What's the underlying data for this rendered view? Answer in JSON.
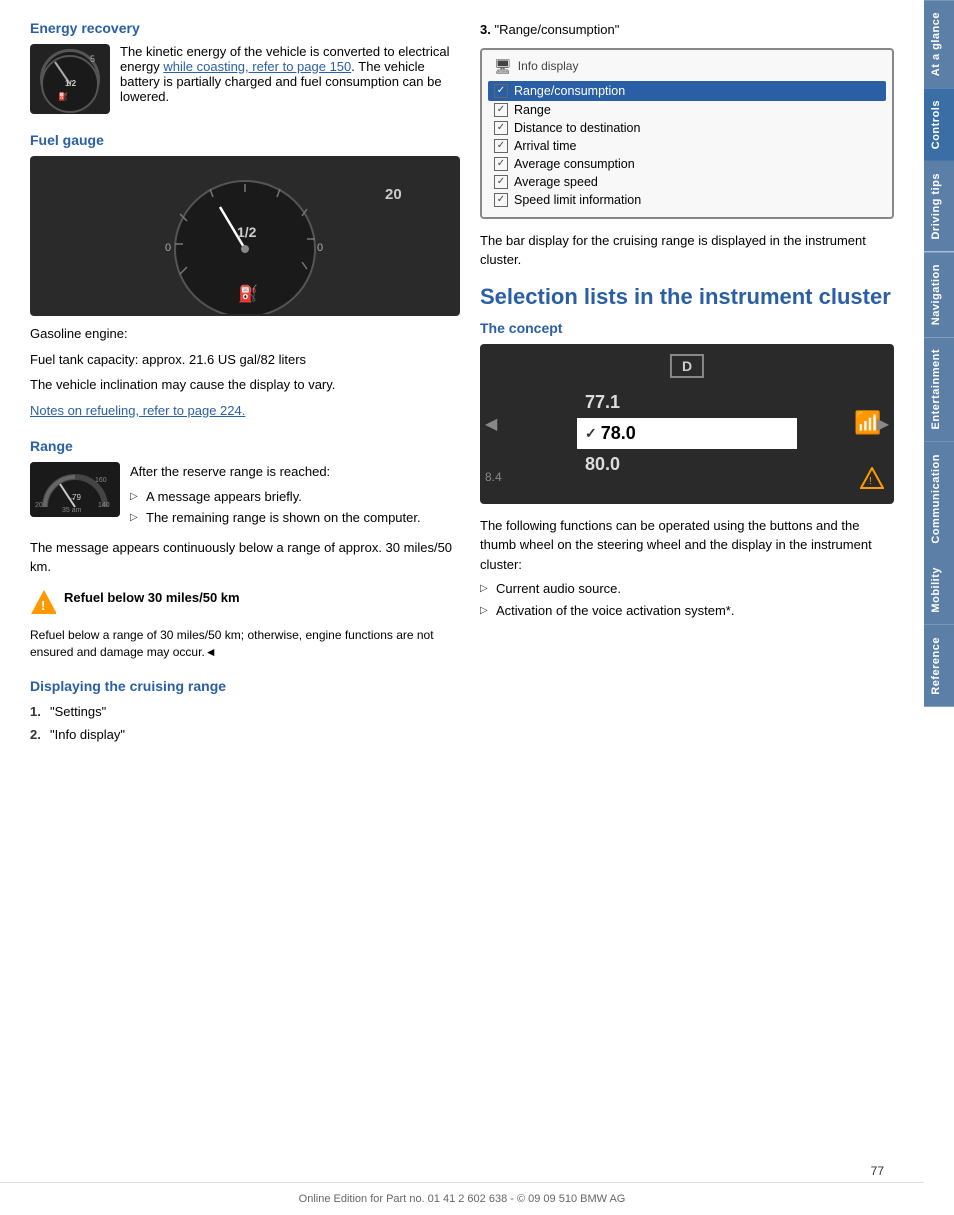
{
  "page": {
    "footer_text": "Online Edition for Part no. 01 41 2 602 638 - © 09 09 510 BMW AG",
    "page_number": "77"
  },
  "sidebar": {
    "tabs": [
      {
        "label": "At a glance",
        "class": "at-glance"
      },
      {
        "label": "Controls",
        "class": "controls"
      },
      {
        "label": "Driving tips",
        "class": "driving-tips"
      },
      {
        "label": "Navigation",
        "class": "navigation"
      },
      {
        "label": "Entertainment",
        "class": "entertainment"
      },
      {
        "label": "Communication",
        "class": "communication"
      },
      {
        "label": "Mobility",
        "class": "mobility"
      },
      {
        "label": "Reference",
        "class": "reference"
      }
    ]
  },
  "left_column": {
    "energy_recovery": {
      "title": "Energy recovery",
      "text_part1": "The kinetic energy of the vehicle is converted to electrical energy ",
      "link_text": "while coasting, refer to page 150",
      "text_part2": ". The vehicle battery is partially charged and fuel consumption can be lowered."
    },
    "fuel_gauge": {
      "title": "Fuel gauge",
      "half_label": "1/2",
      "gasoline_text": "Gasoline engine:",
      "capacity_text": "Fuel tank capacity: approx. 21.6 US gal/82 liters",
      "inclination_text": "The vehicle inclination may cause the display to vary.",
      "notes_link": "Notes on refueling, refer to page 224."
    },
    "range": {
      "title": "Range",
      "after_reserve_text": "After the reserve range is reached:",
      "bullet1": "A message appears briefly.",
      "bullet2": "The remaining range is shown on the computer.",
      "msg_text": "The message appears continuously below a range of approx. 30 miles/50 km.",
      "warning_short": "Refuel below 30 miles/50 km",
      "warning_long": "Refuel below a range of 30 miles/50 km; otherwise, engine functions are not ensured and damage may occur.◄"
    },
    "displaying": {
      "title": "Displaying the cruising range",
      "step1_num": "1.",
      "step1_text": "\"Settings\"",
      "step2_num": "2.",
      "step2_text": "\"Info display\""
    }
  },
  "right_column": {
    "step3_num": "3.",
    "step3_text": "\"Range/consumption\"",
    "info_display_header": "Info display",
    "info_rows": [
      {
        "label": "Range/consumption",
        "highlighted": true
      },
      {
        "label": "Range",
        "highlighted": false
      },
      {
        "label": "Distance to destination",
        "highlighted": false
      },
      {
        "label": "Arrival time",
        "highlighted": false
      },
      {
        "label": "Average consumption",
        "highlighted": false
      },
      {
        "label": "Average speed",
        "highlighted": false
      },
      {
        "label": "Speed limit information",
        "highlighted": false
      }
    ],
    "bar_display_text": "The bar display for the cruising range is displayed in the instrument cluster.",
    "selection_lists_title": "Selection lists in the instrument cluster",
    "concept_title": "The concept",
    "instrument_values": {
      "d_label": "D",
      "val1": "77.1",
      "val2": "78.0",
      "val3": "80.0",
      "side_num": "8.4"
    },
    "concept_body": "The following functions can be operated using the buttons and the thumb wheel on the steering wheel and the display in the instrument cluster:",
    "concept_bullets": [
      "Current audio source.",
      "Activation of the voice activation system*."
    ]
  }
}
